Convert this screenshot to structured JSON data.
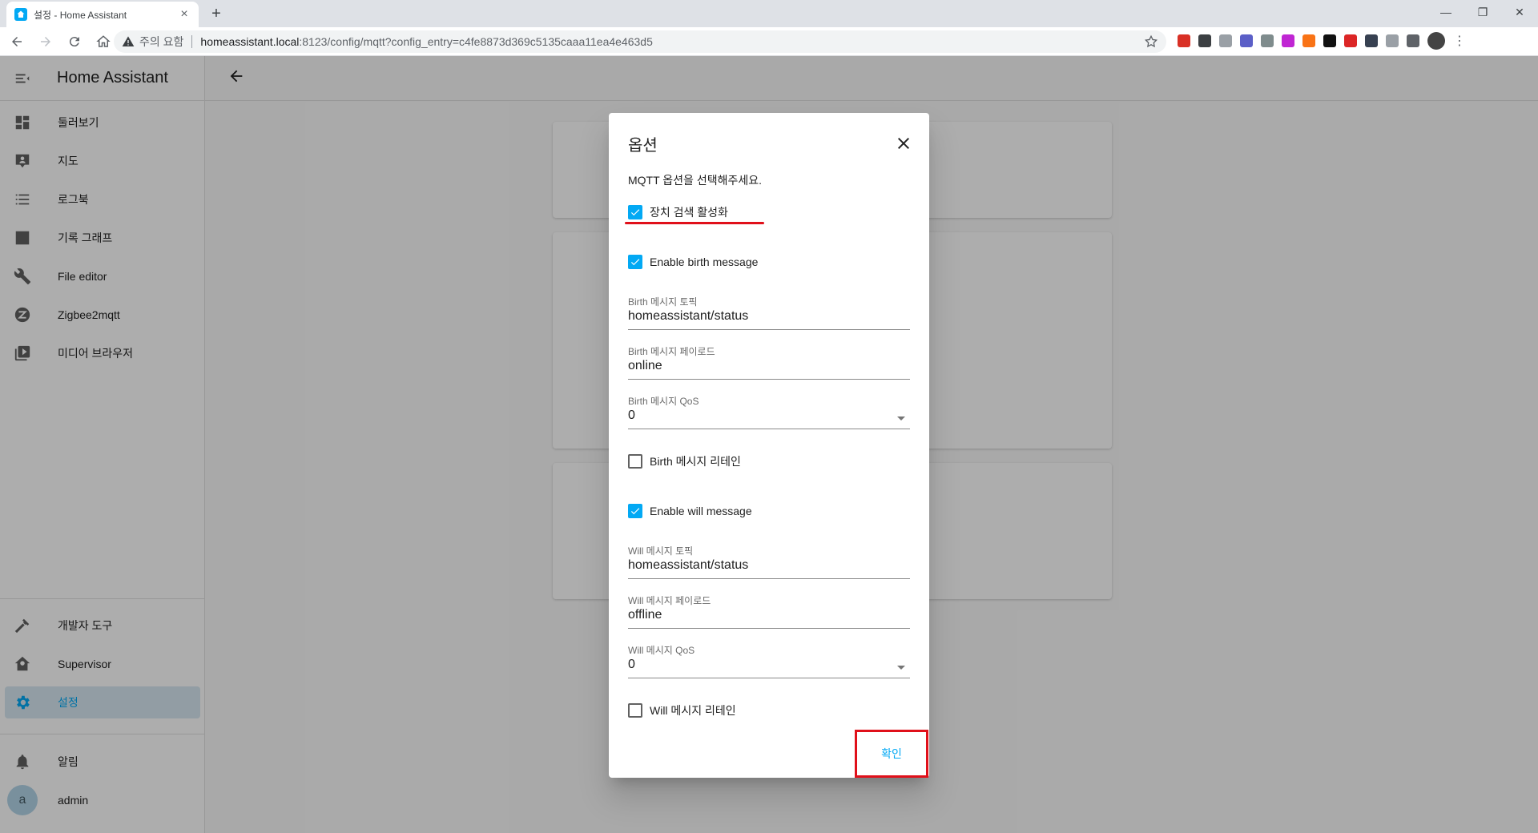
{
  "browser": {
    "tab_title": "설정 - Home Assistant",
    "tab_close": "×",
    "new_tab": "+",
    "warning_text": "주의 요함",
    "url_host": "homeassistant.local",
    "url_path": ":8123/config/mqtt?config_entry=c4fe8873d369c5135caaa11ea4e463d5",
    "menu": "⋮",
    "minimize": "—",
    "restore": "❐",
    "close": "✕",
    "extension_colors": [
      "#d93025",
      "#3c4043",
      "#9aa0a6",
      "#5b5fc7",
      "#7f8c8d",
      "#c026d3",
      "#f97316",
      "#111111",
      "#dc2626",
      "#374151",
      "#9aa0a6",
      "#5f6368"
    ]
  },
  "sidebar": {
    "title": "Home Assistant",
    "items": [
      {
        "label": "둘러보기",
        "icon": "dashboard-icon"
      },
      {
        "label": "지도",
        "icon": "map-icon"
      },
      {
        "label": "로그북",
        "icon": "logbook-icon"
      },
      {
        "label": "기록 그래프",
        "icon": "history-icon"
      },
      {
        "label": "File editor",
        "icon": "wrench-icon"
      },
      {
        "label": "Zigbee2mqtt",
        "icon": "zigbee-icon"
      },
      {
        "label": "미디어 브라우저",
        "icon": "media-icon"
      }
    ],
    "bottom_items": [
      {
        "label": "개발자 도구",
        "icon": "hammer-icon"
      },
      {
        "label": "Supervisor",
        "icon": "supervisor-icon"
      },
      {
        "label": "설정",
        "icon": "gear-icon"
      }
    ],
    "notifications_label": "알림",
    "user_initial": "a",
    "user_name": "admin",
    "accent_color": "#03a9f4"
  },
  "dialog": {
    "title": "옵션",
    "description": "MQTT 옵션을 선택해주세요.",
    "discovery_label": "장치 검색 활성화",
    "discovery_checked": true,
    "birth_enable_label": "Enable birth message",
    "birth_enable_checked": true,
    "birth_topic_label": "Birth 메시지 토픽",
    "birth_topic_value": "homeassistant/status",
    "birth_payload_label": "Birth 메시지 페이로드",
    "birth_payload_value": "online",
    "birth_qos_label": "Birth 메시지 QoS",
    "birth_qos_value": "0",
    "birth_retain_label": "Birth 메시지 리테인",
    "birth_retain_checked": false,
    "will_enable_label": "Enable will message",
    "will_enable_checked": true,
    "will_topic_label": "Will 메시지 토픽",
    "will_topic_value": "homeassistant/status",
    "will_payload_label": "Will 메시지 페이로드",
    "will_payload_value": "offline",
    "will_qos_label": "Will 메시지 QoS",
    "will_qos_value": "0",
    "will_retain_label": "Will 메시지 리테인",
    "will_retain_checked": false,
    "ok_label": "확인",
    "highlight_color": "#e0101a"
  }
}
